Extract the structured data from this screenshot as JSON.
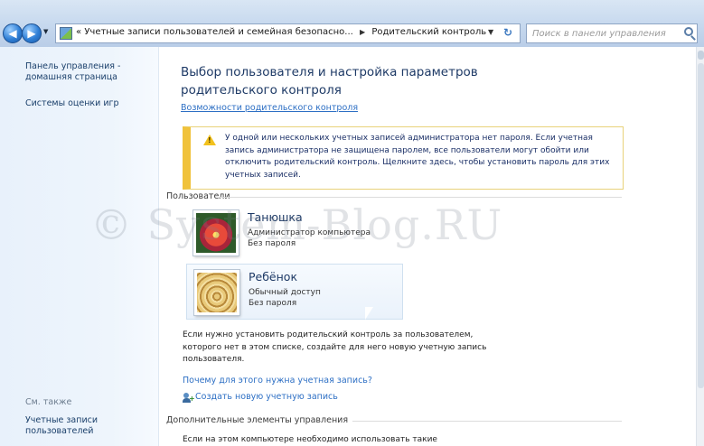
{
  "address_bar": {
    "path_prefix": "«",
    "breadcrumb_parent": "Учетные записи пользователей и семейная безопасно...",
    "breadcrumb_current": "Родительский контроль",
    "search_placeholder": "Поиск в панели управления"
  },
  "sidebar": {
    "home_link": "Панель управления - домашняя страница",
    "game_ratings_link": "Системы оценки игр",
    "see_also_label": "См. также",
    "user_accounts_link": "Учетные записи пользователей"
  },
  "main": {
    "title": "Выбор пользователя и настройка параметров родительского контроля",
    "parental_features_link": "Возможности родительского контроля",
    "warning_text": "У одной или нескольких учетных записей администратора нет пароля. Если учетная запись администратора не защищена паролем, все пользователи могут обойти или отключить родительский контроль. Щелкните здесь, чтобы установить пароль для этих учетных записей.",
    "users_section_label": "Пользователи",
    "users": [
      {
        "name": "Танюшка",
        "type": "Администратор компьютера",
        "password": "Без пароля"
      },
      {
        "name": "Ребёнок",
        "type": "Обычный доступ",
        "password": "Без пароля"
      }
    ],
    "info_text": "Если нужно установить родительский контроль за пользователем, которого нет в этом списке, создайте для него новую учетную запись пользователя.",
    "why_link": "Почему для этого нужна учетная запись?",
    "create_account_link": "Создать новую учетную запись",
    "extra_controls_label": "Дополнительные элементы управления",
    "bottom_text": "Если на этом компьютере необходимо использовать такие"
  },
  "watermark": "© System-Blog.RU",
  "icons": {
    "back": "back-arrow-icon",
    "forward": "forward-arrow-icon",
    "refresh": "refresh-icon",
    "search": "search-icon",
    "warning": "warning-icon",
    "create_user": "add-user-icon"
  },
  "colors": {
    "link": "#2d6fc4",
    "title": "#1e3a66",
    "warning_accent": "#f0c23b",
    "sidebar_bg": "#e8f1fb"
  }
}
